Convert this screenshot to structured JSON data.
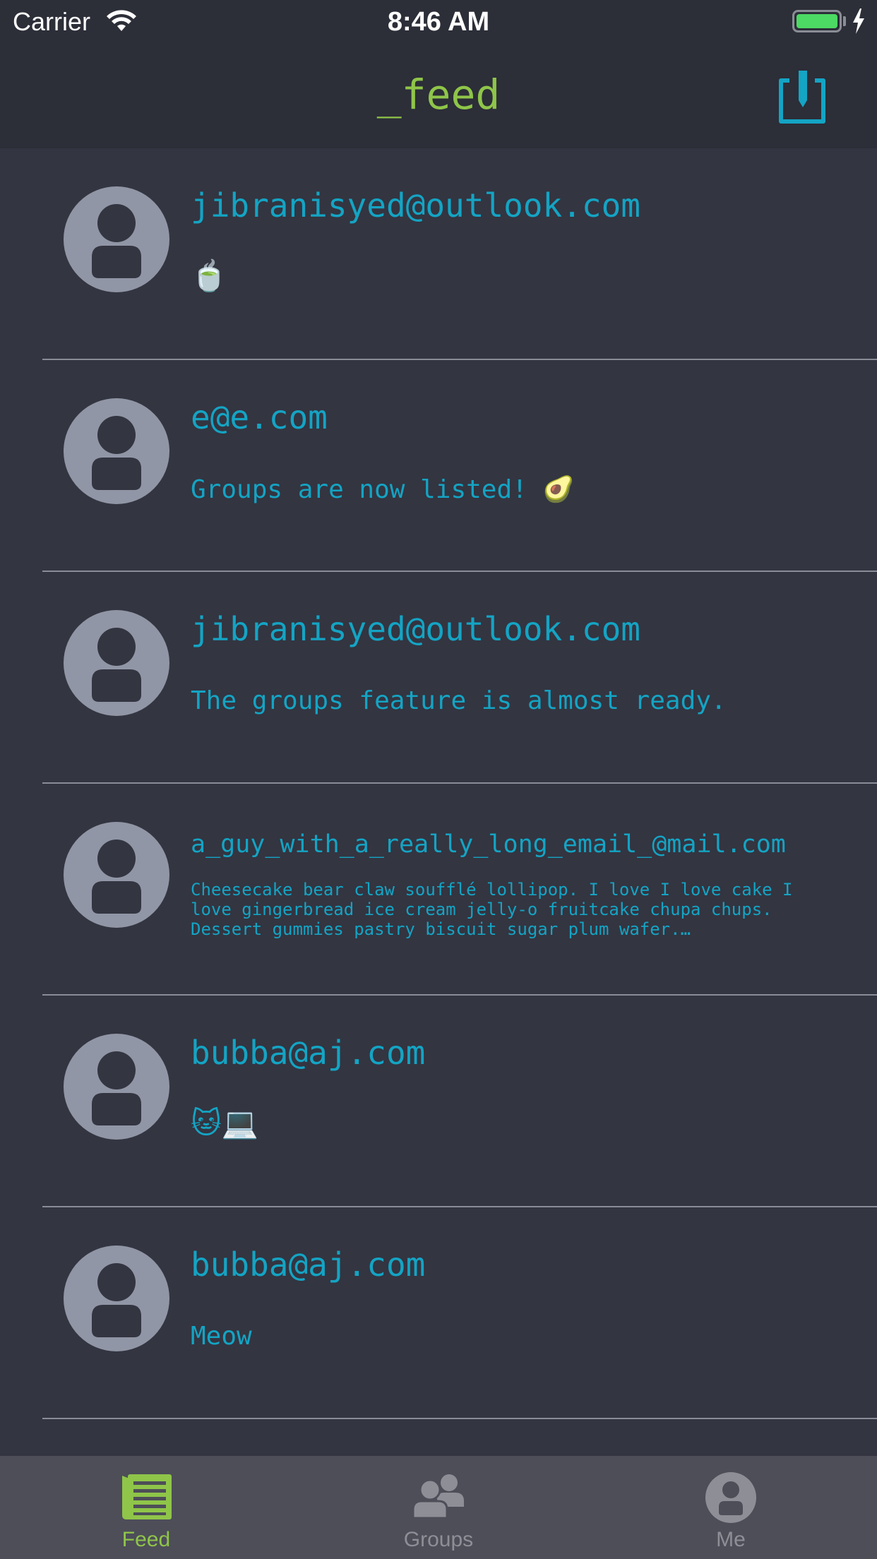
{
  "status_bar": {
    "carrier": "Carrier",
    "time": "8:46 AM",
    "battery_color": "#4cd964"
  },
  "nav": {
    "title": "_feed",
    "title_color": "#8fc549",
    "compose_icon": "compose-icon",
    "accent_color": "#14a4c4"
  },
  "feed": [
    {
      "author": "jibranisyed@outlook.com",
      "post": "🍵",
      "style": "emoji"
    },
    {
      "author": "e@e.com",
      "post": "Groups are now listed! 🥑",
      "style": "normal"
    },
    {
      "author": "jibranisyed@outlook.com",
      "post": "The groups feature is almost ready.",
      "style": "normal"
    },
    {
      "author": "a_guy_with_a_really_long_email_@mail.com",
      "post": "Cheesecake bear claw soufflé lollipop. I love I love cake I love gingerbread ice cream jelly-o fruitcake chupa chups. Dessert gummies pastry biscuit sugar plum wafer.…",
      "style": "small"
    },
    {
      "author": "bubba@aj.com",
      "post": "🐱💻",
      "style": "emoji"
    },
    {
      "author": "bubba@aj.com",
      "post": "Meow",
      "style": "normal"
    }
  ],
  "tabs": [
    {
      "label": "Feed",
      "icon": "feed-icon",
      "active": true,
      "color": "#8fc549"
    },
    {
      "label": "Groups",
      "icon": "groups-icon",
      "active": false,
      "color": "#8e8f96"
    },
    {
      "label": "Me",
      "icon": "profile-icon",
      "active": false,
      "color": "#8e8f96"
    }
  ]
}
